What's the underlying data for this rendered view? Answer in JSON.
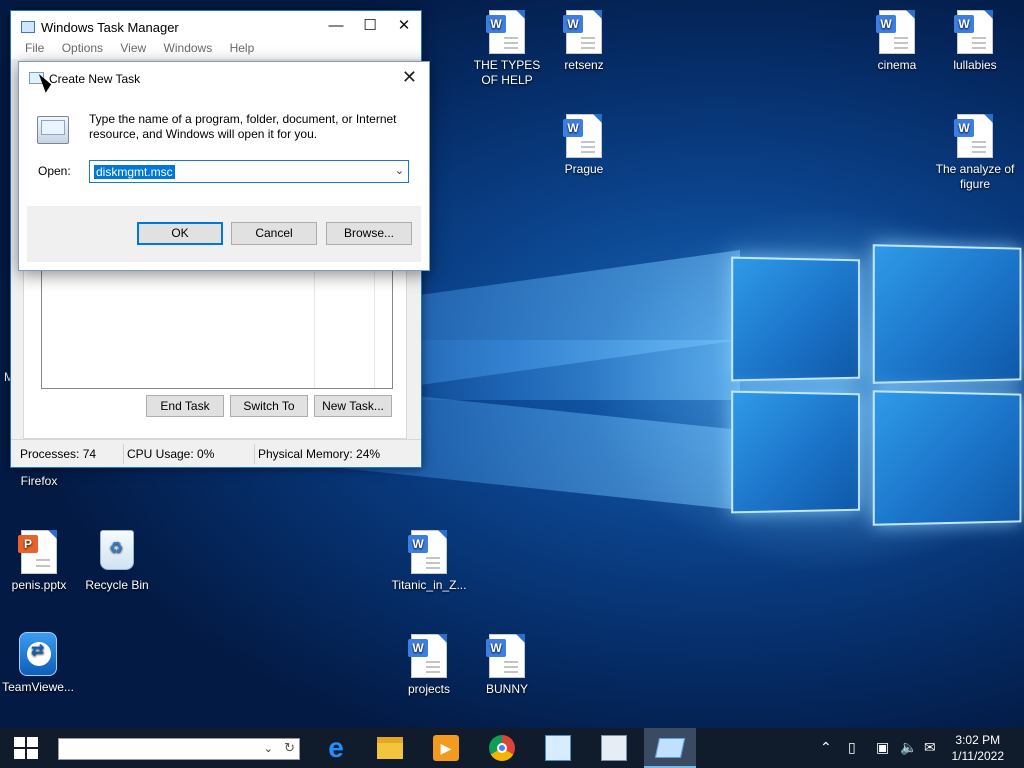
{
  "desktop": {
    "icons": [
      {
        "label": "THE TYPES OF HELP"
      },
      {
        "label": "retsenz"
      },
      {
        "label": "Prague"
      },
      {
        "label": "cinema"
      },
      {
        "label": "lullabies"
      },
      {
        "label": "The analyze of figure"
      },
      {
        "label": "Firefox"
      },
      {
        "label": "penis.pptx"
      },
      {
        "label": "Recycle Bin"
      },
      {
        "label": "Titanic_in_Z..."
      },
      {
        "label": "TeamViewe..."
      },
      {
        "label": "projects"
      },
      {
        "label": "BUNNY"
      }
    ],
    "edge_letter": "M"
  },
  "task_manager": {
    "title": "Windows Task Manager",
    "menu": [
      "File",
      "Options",
      "View",
      "Windows",
      "Help"
    ],
    "buttons": {
      "end_task": "End Task",
      "switch_to": "Switch To",
      "new_task": "New Task..."
    },
    "status": {
      "processes": "Processes: 74",
      "cpu": "CPU Usage: 0%",
      "memory": "Physical Memory: 24%"
    }
  },
  "dialog": {
    "title": "Create New Task",
    "description": "Type the name of a program, folder, document, or Internet resource, and Windows will open it for you.",
    "open_label": "Open:",
    "open_value": "diskmgmt.msc",
    "buttons": {
      "ok": "OK",
      "cancel": "Cancel",
      "browse": "Browse..."
    }
  },
  "taskbar": {
    "search_value": "",
    "clock_time": "3:02 PM",
    "clock_date": "1/11/2022"
  },
  "colors": {
    "accent": "#0078d7",
    "taskbar": "#101c2c"
  }
}
